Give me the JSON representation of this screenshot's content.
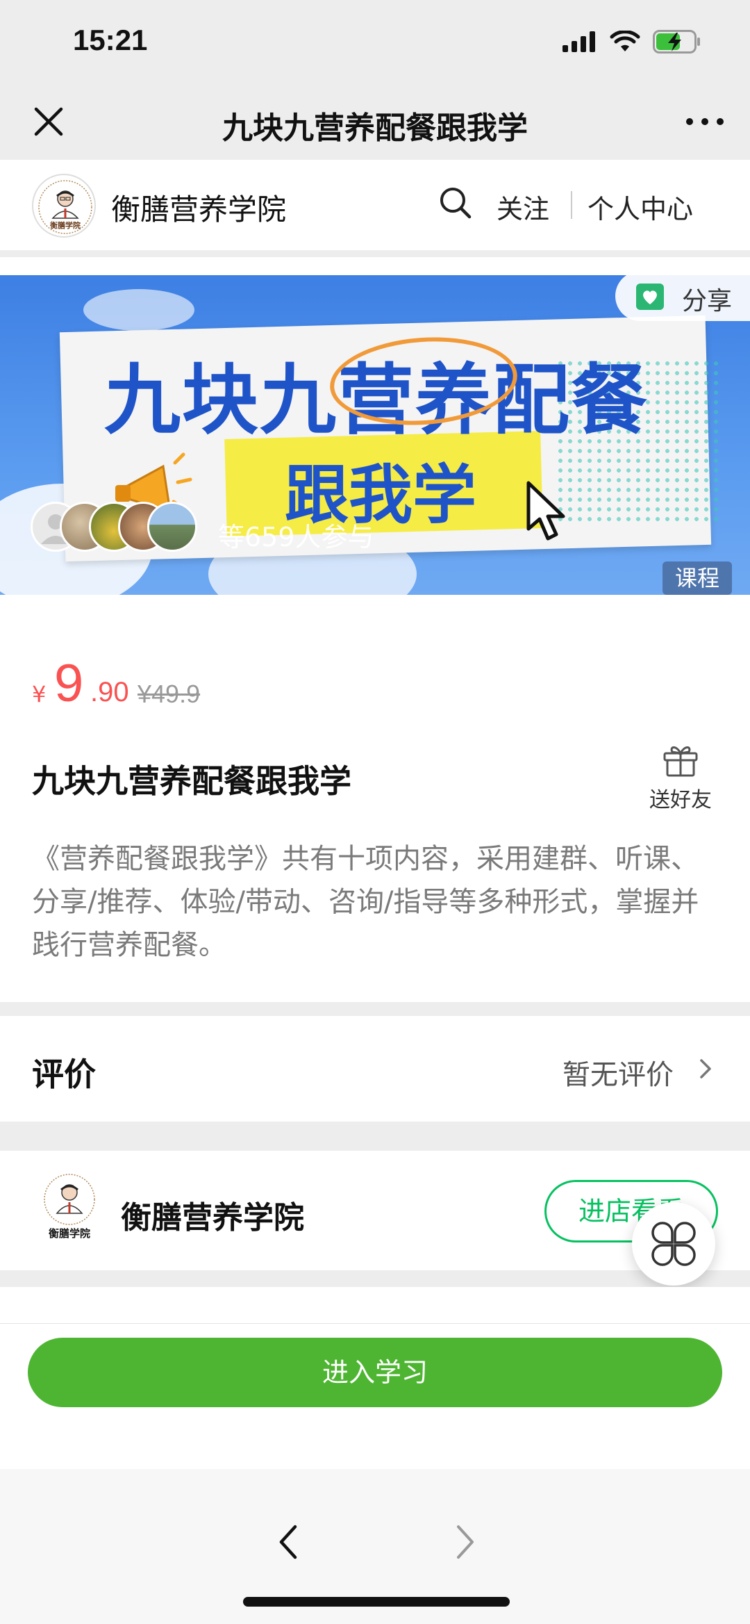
{
  "status_bar": {
    "time": "15:21"
  },
  "nav": {
    "title": "九块九营养配餐跟我学"
  },
  "shop_header": {
    "logo_name": "衡膳学院",
    "name": "衡膳营养学院",
    "follow_label": "关注",
    "personal_center_label": "个人中心"
  },
  "banner": {
    "title": "九块九营养配餐",
    "subtitle": "跟我学",
    "share_label": "分享",
    "participants": "等659人参与",
    "tag": "课程"
  },
  "course": {
    "currency": "¥",
    "price_int": "9",
    "price_dec": ".90",
    "original_price": "¥49.9",
    "title": "九块九营养配餐跟我学",
    "gift_label": "送好友",
    "description": "《营养配餐跟我学》共有十项内容，采用建群、听课、分享/推荐、体验/带动、咨询/指导等多种形式，掌握并践行营养配餐。"
  },
  "reviews": {
    "title": "评价",
    "status": "暂无评价"
  },
  "shop_row": {
    "logo_name": "衡膳学院",
    "name": "衡膳营养学院",
    "visit_label": "进店看看"
  },
  "action": {
    "enter_label": "进入学习"
  },
  "colors": {
    "primary_green": "#07c160",
    "button_green": "#4eb532",
    "price_red": "#fa5151",
    "banner_blue": "#3d7fe3"
  }
}
